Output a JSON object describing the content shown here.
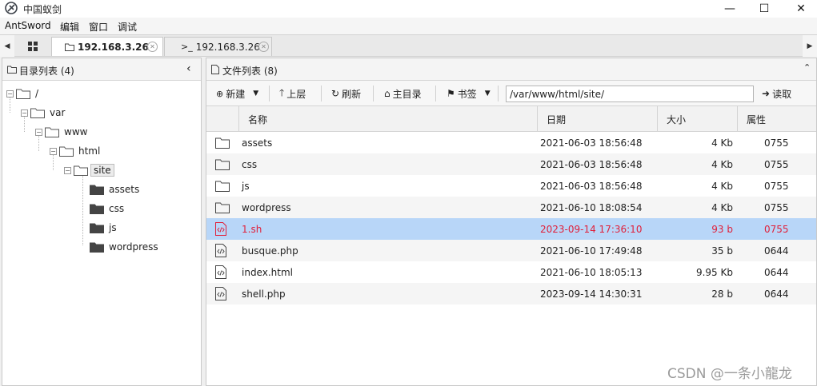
{
  "window": {
    "title": "中国蚁剑",
    "controls": {
      "minimize": "—",
      "maximize": "☐",
      "close": "✕"
    }
  },
  "menubar": [
    "AntSword",
    "编辑",
    "窗口",
    "调试"
  ],
  "tabs": [
    {
      "label": "192.168.3.26",
      "icon": "folder-icon",
      "active": true
    },
    {
      "label": "192.168.3.26",
      "icon": "terminal-icon",
      "active": false
    }
  ],
  "tab_prefix": ">_",
  "left_panel": {
    "title": "目录列表 (4)",
    "tree": [
      {
        "label": "/",
        "depth": 0,
        "type": "open"
      },
      {
        "label": "var",
        "depth": 1,
        "type": "open"
      },
      {
        "label": "www",
        "depth": 2,
        "type": "open"
      },
      {
        "label": "html",
        "depth": 3,
        "type": "open"
      },
      {
        "label": "site",
        "depth": 4,
        "type": "open",
        "selected": true
      },
      {
        "label": "assets",
        "depth": 5,
        "type": "leaf"
      },
      {
        "label": "css",
        "depth": 5,
        "type": "leaf"
      },
      {
        "label": "js",
        "depth": 5,
        "type": "leaf"
      },
      {
        "label": "wordpress",
        "depth": 5,
        "type": "leaf"
      }
    ]
  },
  "right_panel": {
    "title": "文件列表 (8)",
    "toolbar": {
      "new": "新建",
      "up": "上层",
      "refresh": "刷新",
      "home": "主目录",
      "bookmark": "书签",
      "path": "/var/www/html/site/",
      "read": "读取"
    },
    "columns": [
      "名称",
      "日期",
      "大小",
      "属性"
    ],
    "rows": [
      {
        "name": "assets",
        "date": "2021-06-03 18:56:48",
        "size": "4 Kb",
        "attr": "0755",
        "icon": "folder-icon"
      },
      {
        "name": "css",
        "date": "2021-06-03 18:56:48",
        "size": "4 Kb",
        "attr": "0755",
        "icon": "folder-icon"
      },
      {
        "name": "js",
        "date": "2021-06-03 18:56:48",
        "size": "4 Kb",
        "attr": "0755",
        "icon": "folder-icon"
      },
      {
        "name": "wordpress",
        "date": "2021-06-10 18:08:54",
        "size": "4 Kb",
        "attr": "0755",
        "icon": "folder-icon"
      },
      {
        "name": "1.sh",
        "date": "2023-09-14 17:36:10",
        "size": "93 b",
        "attr": "0755",
        "icon": "code-file-icon",
        "selected": true
      },
      {
        "name": "busque.php",
        "date": "2021-06-10 17:49:48",
        "size": "35 b",
        "attr": "0644",
        "icon": "code-file-icon"
      },
      {
        "name": "index.html",
        "date": "2021-06-10 18:05:13",
        "size": "9.95 Kb",
        "attr": "0644",
        "icon": "code-file-icon"
      },
      {
        "name": "shell.php",
        "date": "2023-09-14 14:30:31",
        "size": "28 b",
        "attr": "0644",
        "icon": "code-file-icon"
      }
    ]
  },
  "watermark": "CSDN @一条小龍龙",
  "colors": {
    "selected_row": "#b8d6f8",
    "selected_text": "#e0203a"
  }
}
